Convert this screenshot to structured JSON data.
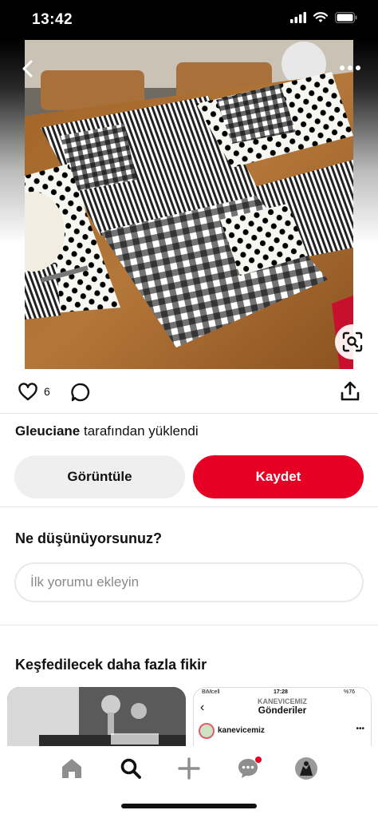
{
  "status_bar": {
    "time": "13:42"
  },
  "pin": {
    "like_count": "6",
    "uploader_name": "Gleuciane",
    "uploader_suffix": " tarafından yüklendi"
  },
  "actions": {
    "view_label": "Görüntüle",
    "save_label": "Kaydet"
  },
  "comments": {
    "title": "Ne düşünüyorsunuz?",
    "placeholder": "İlk yorumu ekleyin"
  },
  "explore": {
    "title": "Keşfedilecek daha fazla fikir",
    "right_card": {
      "carrier": "BiMcell",
      "time": "17:28",
      "battery": "%76",
      "handle": "KANEVICEMIZ",
      "title": "Gönderiler",
      "username": "kanevicemiz"
    }
  },
  "colors": {
    "brand_red": "#e60023",
    "button_gray": "#efefef"
  },
  "icons": {
    "back": "chevron-left-icon",
    "more": "more-dots-icon",
    "lens": "visual-search-icon",
    "like": "heart-icon",
    "comment": "comment-bubble-icon",
    "share": "share-icon",
    "nav": [
      "home-icon",
      "search-icon",
      "plus-icon",
      "messages-icon",
      "profile-avatar"
    ]
  }
}
